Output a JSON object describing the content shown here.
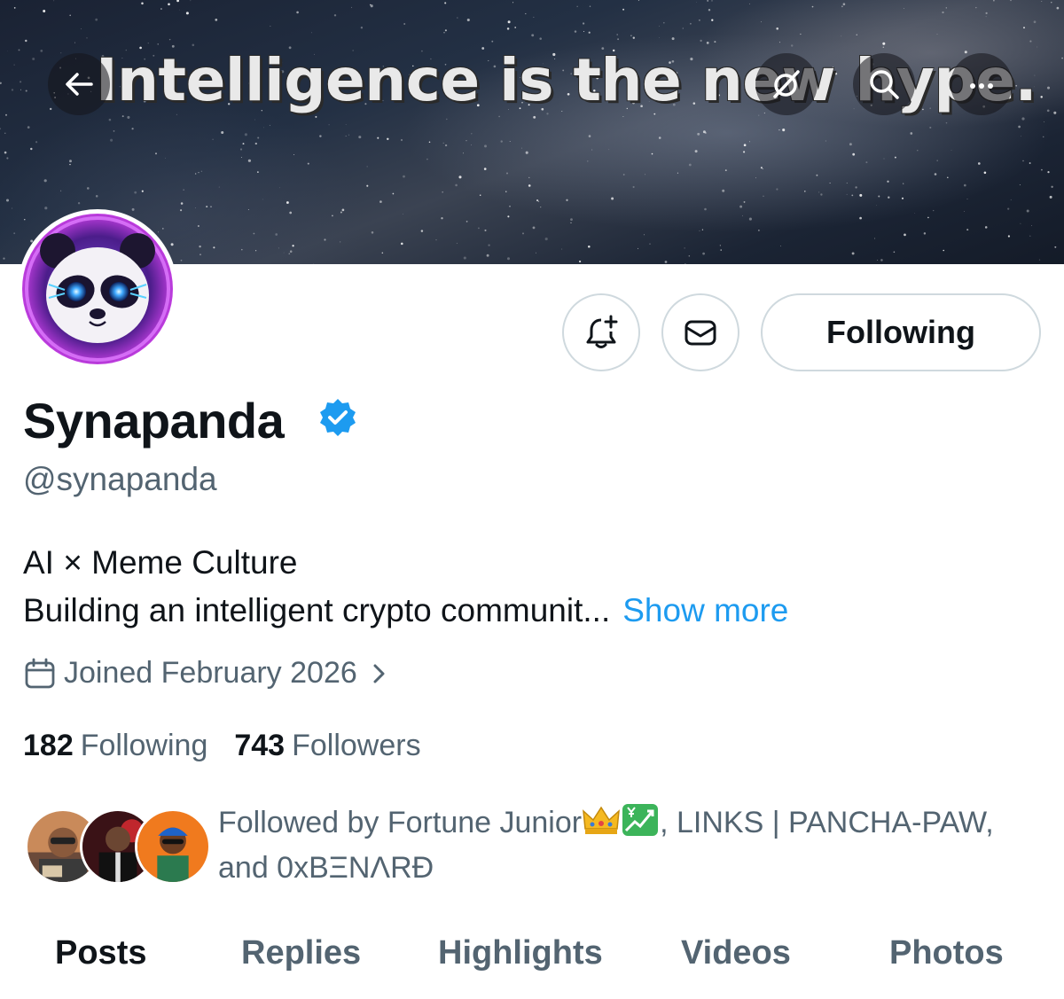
{
  "banner": {
    "headline": "Intelligence is the new hype."
  },
  "profile": {
    "display_name": "Synapanda",
    "handle": "@synapanda",
    "bio_line1": "AI × Meme Culture",
    "bio_line2": "Building an intelligent crypto communit...",
    "show_more": "Show more",
    "joined": "Joined February 2026",
    "verified_color": "#1d9bf0"
  },
  "actions": {
    "notify_icon": "bell-plus-icon",
    "message_icon": "envelope-icon",
    "follow_label": "Following"
  },
  "stats": {
    "following_count": "182",
    "following_label": "Following",
    "followers_count": "743",
    "followers_label": "Followers"
  },
  "followed_by": {
    "prefix": "Followed by Fortune Junior",
    "emojis": [
      "crown-emoji",
      "chart-yen-emoji"
    ],
    "rest_line1": ", LINKS | PANCHA-PAW,",
    "line2": "and 0xBΞNΛRĐ"
  },
  "tabs": [
    {
      "label": "Posts",
      "active": true
    },
    {
      "label": "Replies",
      "active": false
    },
    {
      "label": "Highlights",
      "active": false
    },
    {
      "label": "Videos",
      "active": false
    },
    {
      "label": "Photos",
      "active": false
    }
  ],
  "colors": {
    "accent": "#1d9bf0",
    "text_primary": "#0f1419",
    "text_secondary": "#536471",
    "border": "#cfd9de"
  }
}
